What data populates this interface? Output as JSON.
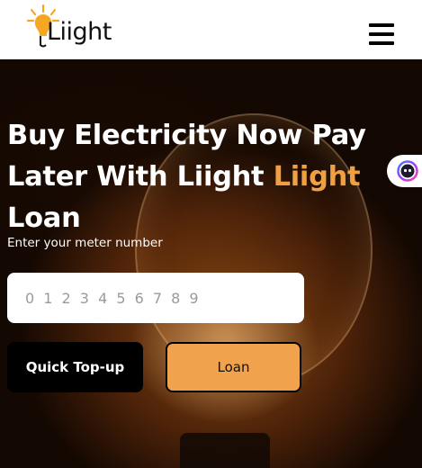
{
  "header": {
    "logo_text": "Liight"
  },
  "hero": {
    "title_main": "Buy Electricity Now Pay Later With Liight ",
    "title_accent": "Liight",
    "title_end": "Loan",
    "meter_label": "Enter your meter number",
    "meter_placeholder": "0 1 2 3 4 5 6 7 8 9",
    "meter_value": ""
  },
  "buttons": {
    "topup_label": "Quick Top-up",
    "loan_label": "Loan"
  },
  "icons": {
    "logo": "lightbulb-logo-icon",
    "menu": "hamburger-menu-icon",
    "chat": "chat-bot-icon"
  },
  "colors": {
    "accent": "#f0a040",
    "loan_button": "#f0a24c",
    "topup_button": "#000000",
    "header_bg": "#ffffff"
  }
}
